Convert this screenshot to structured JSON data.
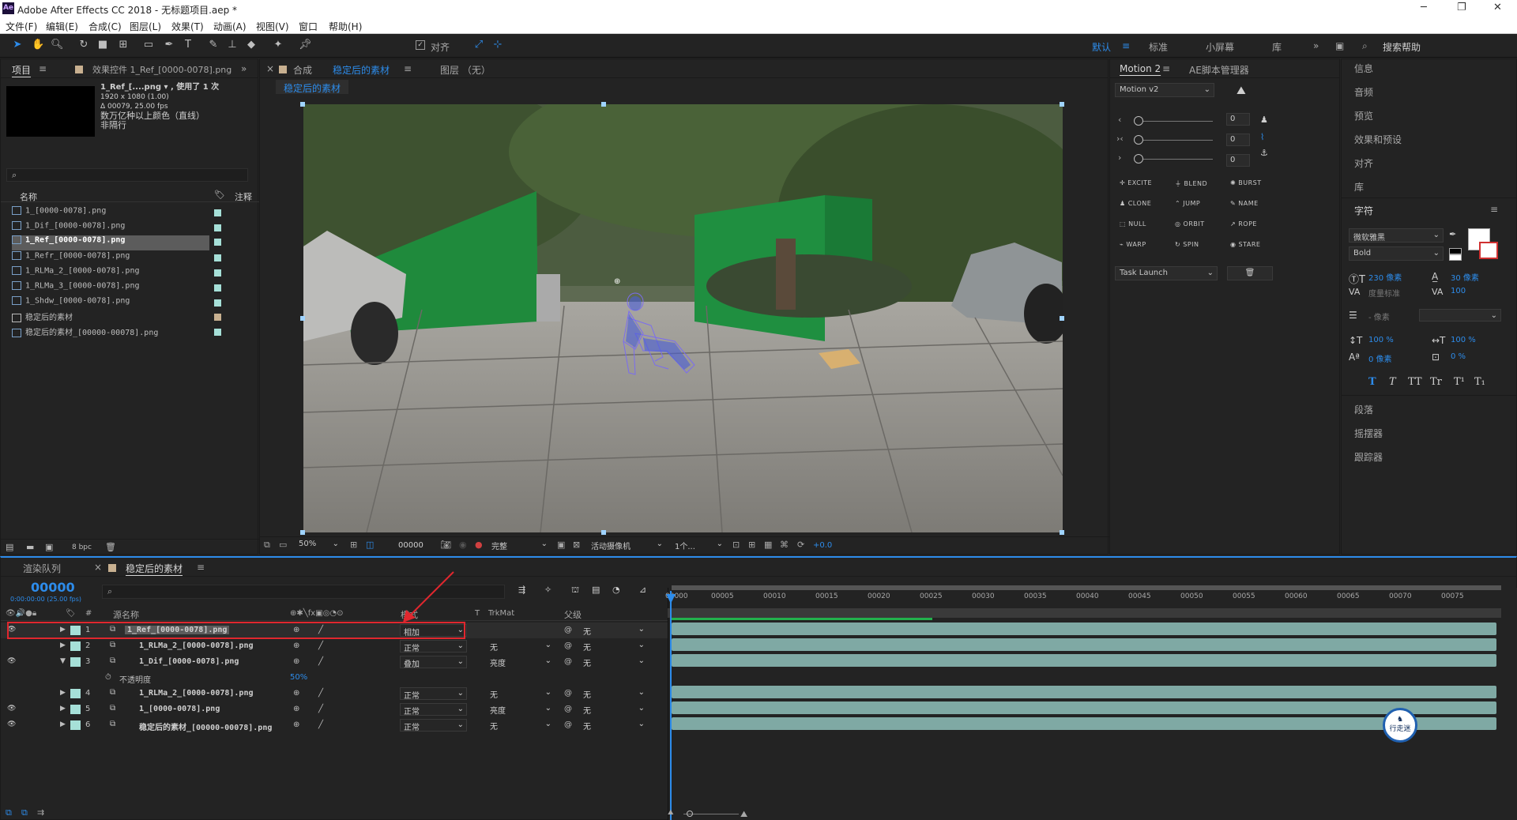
{
  "window": {
    "title": "Adobe After Effects CC 2018 - 无标题项目.aep *",
    "logo": "Ae"
  },
  "menu": [
    "文件(F)",
    "编辑(E)",
    "合成(C)",
    "图层(L)",
    "效果(T)",
    "动画(A)",
    "视图(V)",
    "窗口",
    "帮助(H)"
  ],
  "toolbar": {
    "align_label": "对齐",
    "workspaces": [
      "默认",
      "标准",
      "小屏幕",
      "库"
    ],
    "search_placeholder": "搜索帮助"
  },
  "project_panel": {
    "tab_project": "项目",
    "tab_effects": "效果控件 1_Ref_[0000-0078].png",
    "preview_name": "1_Ref_[....png ▾ , 使用了 1 次",
    "preview_dims": "1920 x 1080 (1.00)",
    "preview_dur": "Δ 00079, 25.00 fps",
    "preview_colors": "数万亿种以上颜色（直线）",
    "preview_interlace": "非隔行",
    "col_name": "名称",
    "col_note": "注释",
    "items": [
      "1_[0000-0078].png",
      "1_Dif_[0000-0078].png",
      "1_Ref_[0000-0078].png",
      "1_Refr_[0000-0078].png",
      "1_RLMa_2_[0000-0078].png",
      "1_RLMa_3_[0000-0078].png",
      "1_Shdw_[0000-0078].png",
      "稳定后的素材",
      "稳定后的素材_[00000-00078].png"
    ],
    "bpc": "8 bpc"
  },
  "comp_panel": {
    "tab_comp": "合成",
    "comp_name": "稳定后的素材",
    "tab_layer": "图层 （无）",
    "breadcrumb": "稳定后的素材",
    "zoom": "50%",
    "timecode": "00000",
    "resolution": "完整",
    "camera": "活动摄像机",
    "views": "1个...",
    "exposure": "+0.0"
  },
  "motion_panel": {
    "tab_motion": "Motion 2",
    "tab_ae": "AE脚本管理器",
    "version": "Motion v2",
    "slider_values": [
      "0",
      "0",
      "0"
    ],
    "buttons": [
      "EXCITE",
      "BLEND",
      "BURST",
      "CLONE",
      "JUMP",
      "NAME",
      "NULL",
      "ORBIT",
      "ROPE",
      "WARP",
      "SPIN",
      "STARE"
    ],
    "task": "Task Launch"
  },
  "right_panel": {
    "items_top": [
      "信息",
      "音频",
      "预览",
      "效果和预设",
      "对齐",
      "库"
    ],
    "char_title": "字符",
    "font": "微软雅黑",
    "style": "Bold",
    "size": "230 像素",
    "leading": "30 像素",
    "kerning": "度量标准",
    "tracking": "100",
    "stroke": "- 像素",
    "vscale": "100 %",
    "hscale": "100 %",
    "baseline": "0 像素",
    "tsume": "0 %",
    "typo_buttons": [
      "T",
      "T",
      "TT",
      "Tr",
      "T¹",
      "T₁"
    ],
    "items_bottom": [
      "段落",
      "摇摆器",
      "跟踪器"
    ]
  },
  "timeline": {
    "tab_render": "渲染队列",
    "tab_comp": "稳定后的素材",
    "timecode": "00000",
    "timecode_sub": "0:00:00:00 (25.00 fps)",
    "col_source": "源名称",
    "col_mode": "模式",
    "col_trkmat": "TrkMat",
    "col_parent": "父级",
    "layers": [
      {
        "num": "1",
        "name": "1_Ref_[0000-0078].png",
        "mode": "相加",
        "trk": "",
        "parent": "无"
      },
      {
        "num": "2",
        "name": "1_RLMa_2_[0000-0078].png",
        "mode": "正常",
        "trk": "无",
        "parent": "无"
      },
      {
        "num": "3",
        "name": "1_Dif_[0000-0078].png",
        "mode": "叠加",
        "trk": "亮度",
        "parent": "无"
      },
      {
        "num": "4",
        "name": "1_RLMa_2_[0000-0078].png",
        "mode": "正常",
        "trk": "无",
        "parent": "无"
      },
      {
        "num": "5",
        "name": "1_[0000-0078].png",
        "mode": "正常",
        "trk": "亮度",
        "parent": "无"
      },
      {
        "num": "6",
        "name": "稳定后的素材_[00000-00078].png",
        "mode": "正常",
        "trk": "无",
        "parent": "无"
      }
    ],
    "opacity_label": "不透明度",
    "opacity_value": "50%",
    "ruler": [
      "00000",
      "00005",
      "00010",
      "00015",
      "00020",
      "00025",
      "00030",
      "00035",
      "00040",
      "00045",
      "00050",
      "00055",
      "00060",
      "00065",
      "00070",
      "00075"
    ],
    "watermark": "行走迷"
  },
  "colors": {
    "accent": "#2d8ceb",
    "layer_label": "#a6e0d8",
    "highlight": "#e0272e",
    "bar": "#7fa9a4"
  }
}
